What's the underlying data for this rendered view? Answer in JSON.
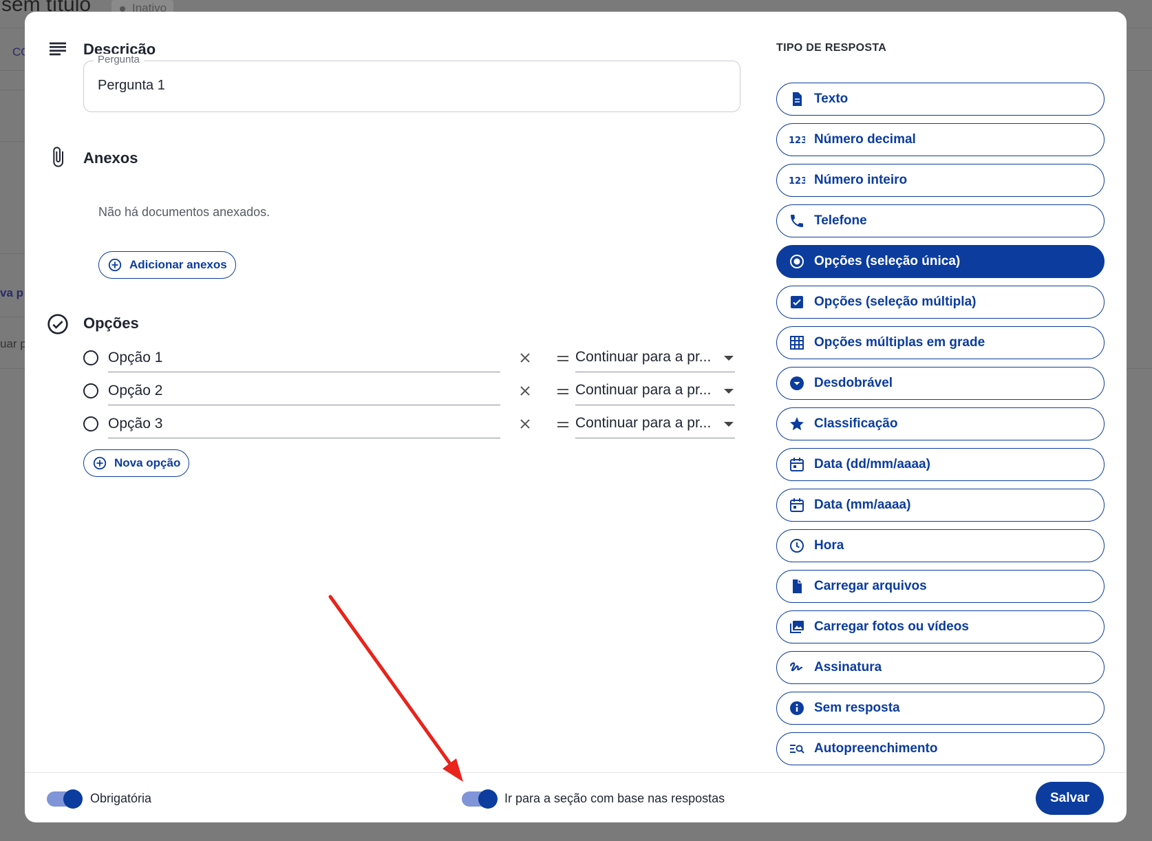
{
  "background": {
    "title": "sem título",
    "status": "Inativo",
    "fragments": [
      "CO",
      "va p",
      "uar p"
    ]
  },
  "description": {
    "title": "Descrição",
    "field_label": "Pergunta",
    "field_value": "Pergunta 1"
  },
  "attachments": {
    "title": "Anexos",
    "empty_text": "Não há documentos anexados.",
    "add_label": "Adicionar anexos"
  },
  "options": {
    "title": "Opções",
    "items": [
      {
        "label": "Opção 1",
        "action": "Continuar para a pr..."
      },
      {
        "label": "Opção 2",
        "action": "Continuar para a pr..."
      },
      {
        "label": "Opção 3",
        "action": "Continuar para a pr..."
      }
    ],
    "new_option_label": "Nova opção"
  },
  "response_type": {
    "title": "TIPO DE RESPOSTA",
    "selected": "Opções (seleção única)",
    "types": [
      {
        "label": "Texto",
        "icon": "document-icon"
      },
      {
        "label": "Número decimal",
        "icon": "numbers-icon"
      },
      {
        "label": "Número inteiro",
        "icon": "numbers-icon"
      },
      {
        "label": "Telefone",
        "icon": "phone-icon"
      },
      {
        "label": "Opções (seleção única)",
        "icon": "radio-icon"
      },
      {
        "label": "Opções (seleção múltipla)",
        "icon": "checkbox-icon"
      },
      {
        "label": "Opções múltiplas em grade",
        "icon": "grid-icon"
      },
      {
        "label": "Desdobrável",
        "icon": "dropdown-icon"
      },
      {
        "label": "Classificação",
        "icon": "star-icon"
      },
      {
        "label": "Data (dd/mm/aaaa)",
        "icon": "calendar-icon"
      },
      {
        "label": "Data (mm/aaaa)",
        "icon": "calendar-icon"
      },
      {
        "label": "Hora",
        "icon": "clock-icon"
      },
      {
        "label": "Carregar arquivos",
        "icon": "file-icon"
      },
      {
        "label": "Carregar fotos ou vídeos",
        "icon": "photos-icon"
      },
      {
        "label": "Assinatura",
        "icon": "signature-icon"
      },
      {
        "label": "Sem resposta",
        "icon": "info-icon"
      },
      {
        "label": "Autopreenchimento",
        "icon": "autofill-icon"
      }
    ]
  },
  "footer": {
    "required_label": "Obrigatória",
    "required_on": true,
    "branching_label": "Ir para a seção com base nas respostas",
    "branching_on": true,
    "save_label": "Salvar"
  },
  "colors": {
    "primary": "#0b3c9e",
    "toggle_track": "#7f95d8",
    "annotation_arrow": "#e8241c"
  }
}
